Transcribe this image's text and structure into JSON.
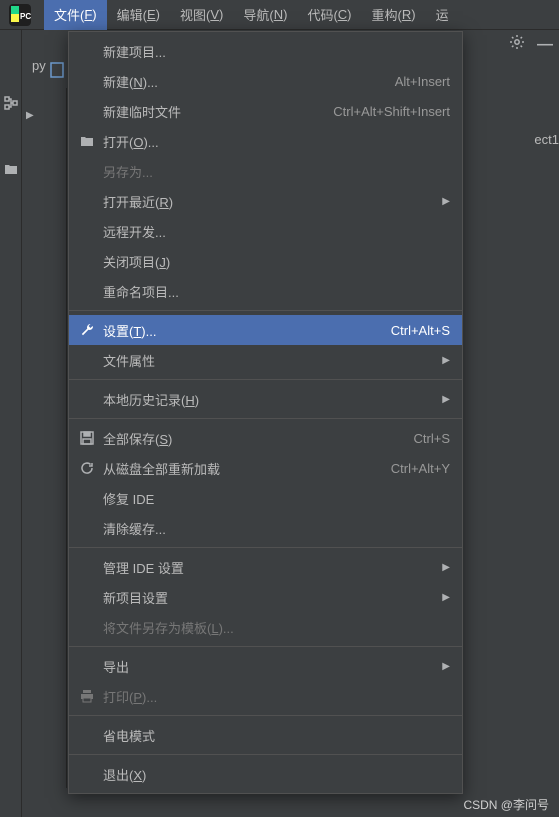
{
  "menubar": {
    "items": [
      {
        "pre": "文件(",
        "u": "F",
        "post": ")",
        "active": true
      },
      {
        "pre": "编辑(",
        "u": "E",
        "post": ")"
      },
      {
        "pre": "视图(",
        "u": "V",
        "post": ")"
      },
      {
        "pre": "导航(",
        "u": "N",
        "post": ")"
      },
      {
        "pre": "代码(",
        "u": "C",
        "post": ")"
      },
      {
        "pre": "重构(",
        "u": "R",
        "post": ")"
      },
      {
        "pre": "运",
        "u": "",
        "post": ""
      }
    ]
  },
  "project_label": "py",
  "breadcrumb_frag": "ect1",
  "dropdown": [
    {
      "type": "item",
      "label": "新建项目..."
    },
    {
      "type": "item",
      "pre": "新建(",
      "u": "N",
      "post": ")...",
      "shortcut": "Alt+Insert"
    },
    {
      "type": "item",
      "label": "新建临时文件",
      "shortcut": "Ctrl+Alt+Shift+Insert"
    },
    {
      "type": "item",
      "pre": "打开(",
      "u": "O",
      "post": ")...",
      "icon": "folder"
    },
    {
      "type": "item",
      "label": "另存为...",
      "disabled": true
    },
    {
      "type": "item",
      "pre": "打开最近(",
      "u": "R",
      "post": ")",
      "submenu": true
    },
    {
      "type": "item",
      "label": "远程开发..."
    },
    {
      "type": "item",
      "pre": "关闭项目(",
      "u": "J",
      "post": ")"
    },
    {
      "type": "item",
      "label": "重命名项目..."
    },
    {
      "type": "sep"
    },
    {
      "type": "item",
      "pre": "设置(",
      "u": "T",
      "post": ")...",
      "shortcut": "Ctrl+Alt+S",
      "selected": true,
      "icon": "wrench"
    },
    {
      "type": "item",
      "label": "文件属性",
      "submenu": true
    },
    {
      "type": "sep"
    },
    {
      "type": "item",
      "pre": "本地历史记录(",
      "u": "H",
      "post": ")",
      "submenu": true
    },
    {
      "type": "sep"
    },
    {
      "type": "item",
      "pre": "全部保存(",
      "u": "S",
      "post": ")",
      "shortcut": "Ctrl+S",
      "icon": "save"
    },
    {
      "type": "item",
      "label": "从磁盘全部重新加载",
      "shortcut": "Ctrl+Alt+Y",
      "icon": "reload"
    },
    {
      "type": "item",
      "label": "修复 IDE"
    },
    {
      "type": "item",
      "label": "清除缓存..."
    },
    {
      "type": "sep"
    },
    {
      "type": "item",
      "label": "管理 IDE 设置",
      "submenu": true
    },
    {
      "type": "item",
      "label": "新项目设置",
      "submenu": true
    },
    {
      "type": "item",
      "pre": "将文件另存为模板(",
      "u": "L",
      "post": ")...",
      "disabled": true
    },
    {
      "type": "sep"
    },
    {
      "type": "item",
      "label": "导出",
      "submenu": true
    },
    {
      "type": "item",
      "pre": "打印(",
      "u": "P",
      "post": ")...",
      "icon": "print",
      "disabled": true
    },
    {
      "type": "sep"
    },
    {
      "type": "item",
      "label": "省电模式"
    },
    {
      "type": "sep"
    },
    {
      "type": "item",
      "pre": "退出(",
      "u": "X",
      "post": ")"
    }
  ],
  "watermark": "CSDN @李问号"
}
